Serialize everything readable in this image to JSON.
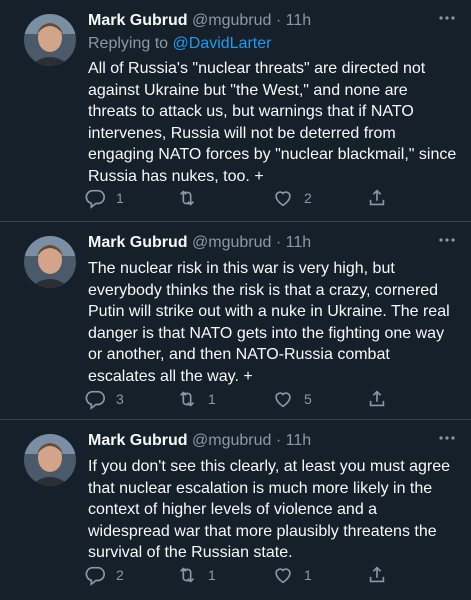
{
  "tweets": [
    {
      "author": "Mark Gubrud",
      "handle": "@mgubrud",
      "separator": "·",
      "time": "11h",
      "replying_prefix": "Replying to ",
      "replying_to": "@DavidLarter",
      "text": "All of Russia's \"nuclear threats\" are directed not against Ukraine but \"the West,\" and none are threats to attack us, but warnings that if NATO intervenes, Russia will not be deterred from engaging NATO forces by \"nuclear blackmail,\" since Russia has nukes, too. +",
      "replies": "1",
      "retweets": "",
      "likes": "2"
    },
    {
      "author": "Mark Gubrud",
      "handle": "@mgubrud",
      "separator": "·",
      "time": "11h",
      "text": "The nuclear risk in this war is very high, but everybody thinks the risk is that a crazy, cornered Putin will strike out with a nuke in Ukraine. The real danger is that NATO gets into the fighting one way or another, and then NATO-Russia combat escalates all the way. +",
      "replies": "3",
      "retweets": "1",
      "likes": "5"
    },
    {
      "author": "Mark Gubrud",
      "handle": "@mgubrud",
      "separator": "·",
      "time": "11h",
      "text": "If you don't see this clearly, at least you must agree that nuclear escalation is much more likely in the context of higher levels of violence and a widespread war that more plausibly threatens the survival of the Russian state.",
      "replies": "2",
      "retweets": "1",
      "likes": "1"
    }
  ],
  "icons": {
    "more": "more-horizontal-icon",
    "reply": "reply-icon",
    "retweet": "retweet-icon",
    "like": "heart-icon",
    "share": "share-icon"
  },
  "colors": {
    "background": "#15202b",
    "text": "#f7f9f9",
    "muted": "#8b98a5",
    "link": "#1d9bf0",
    "divider": "#38444d"
  }
}
